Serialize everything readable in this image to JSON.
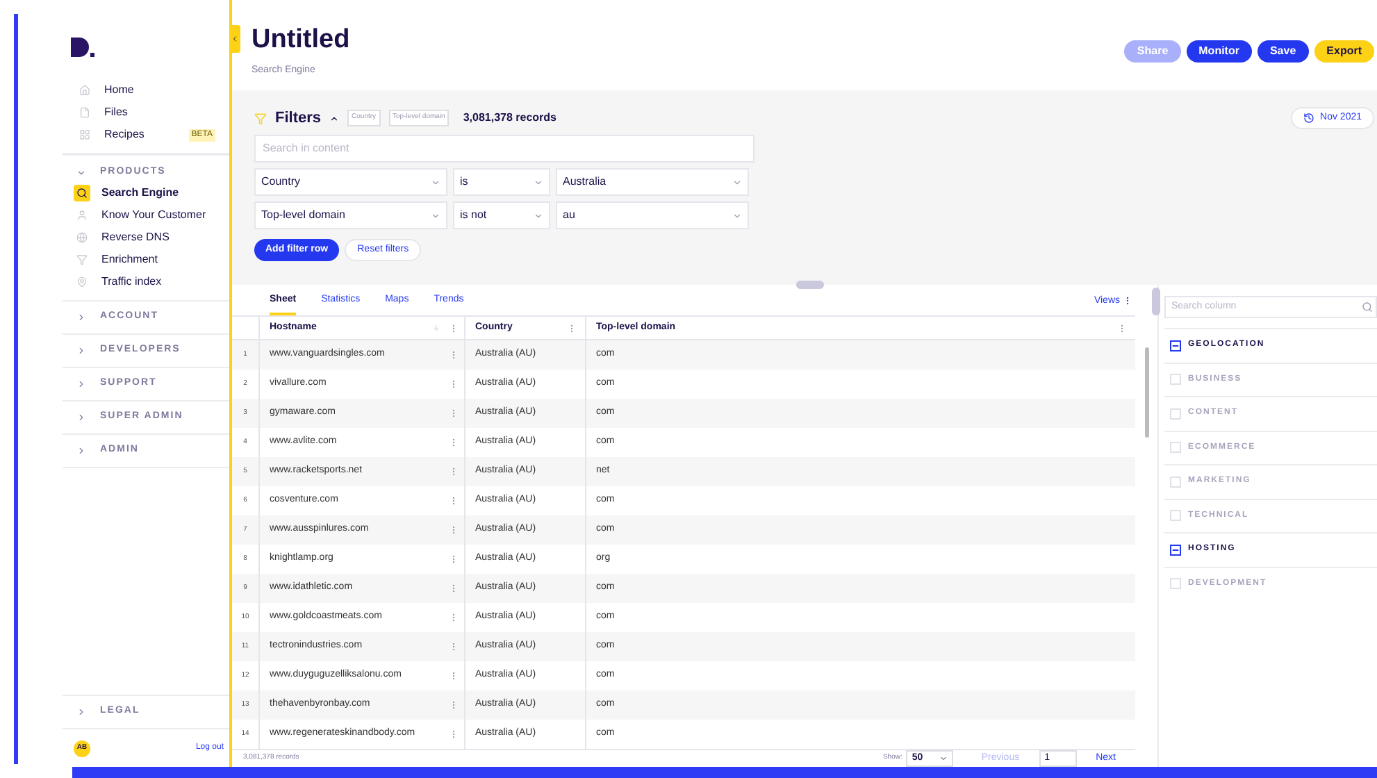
{
  "sidebar": {
    "nav": [
      {
        "label": "Home"
      },
      {
        "label": "Files"
      },
      {
        "label": "Recipes",
        "badge": "BETA"
      }
    ],
    "products": {
      "label": "PRODUCTS",
      "expanded": true,
      "items": [
        {
          "label": "Search Engine",
          "selected": true
        },
        {
          "label": "Know Your Customer",
          "selected": false
        },
        {
          "label": "Reverse DNS",
          "selected": false
        },
        {
          "label": "Enrichment",
          "selected": false
        },
        {
          "label": "Traffic index",
          "selected": false
        }
      ]
    },
    "sections": [
      {
        "label": "ACCOUNT",
        "expanded": false
      },
      {
        "label": "DEVELOPERS",
        "expanded": false
      },
      {
        "label": "SUPPORT",
        "expanded": false
      },
      {
        "label": "SUPER ADMIN",
        "expanded": false
      },
      {
        "label": "ADMIN",
        "expanded": false
      }
    ],
    "legal": {
      "label": "LEGAL",
      "expanded": false
    },
    "user": {
      "initials": "AB",
      "logout": "Log out"
    }
  },
  "header": {
    "title": "Untitled",
    "subtitle": "Search Engine",
    "buttons": [
      {
        "label": "Share",
        "kind": "disabled"
      },
      {
        "label": "Monitor",
        "kind": "primary"
      },
      {
        "label": "Save",
        "kind": "primary"
      },
      {
        "label": "Export",
        "kind": "accent"
      }
    ]
  },
  "filters": {
    "title": "Filters",
    "expanded": true,
    "tags": [
      "Country",
      "Top-level domain"
    ],
    "record_count": "3,081,378 records",
    "date": "Nov 2021",
    "search": {
      "placeholder": "Search in content"
    },
    "rows": [
      {
        "field": "Country",
        "operator": "is",
        "value": "Australia"
      },
      {
        "field": "Top-level domain",
        "operator": "is not",
        "value": "au"
      }
    ],
    "add_button": "Add filter row",
    "reset_button": "Reset filters"
  },
  "tabs": [
    {
      "label": "Sheet",
      "selected": true
    },
    {
      "label": "Statistics",
      "selected": false
    },
    {
      "label": "Maps",
      "selected": false
    },
    {
      "label": "Trends",
      "selected": false
    }
  ],
  "views": "Views",
  "table": {
    "columns": [
      "Hostname",
      "Country",
      "Top-level domain"
    ],
    "rows": [
      {
        "n": "1",
        "hostname": "www.vanguardsingles.com",
        "country": "Australia (AU)",
        "tld": "com"
      },
      {
        "n": "2",
        "hostname": "vivallure.com",
        "country": "Australia (AU)",
        "tld": "com"
      },
      {
        "n": "3",
        "hostname": "gymaware.com",
        "country": "Australia (AU)",
        "tld": "com"
      },
      {
        "n": "4",
        "hostname": "www.avlite.com",
        "country": "Australia (AU)",
        "tld": "com"
      },
      {
        "n": "5",
        "hostname": "www.racketsports.net",
        "country": "Australia (AU)",
        "tld": "net"
      },
      {
        "n": "6",
        "hostname": "cosventure.com",
        "country": "Australia (AU)",
        "tld": "com"
      },
      {
        "n": "7",
        "hostname": "www.ausspinlures.com",
        "country": "Australia (AU)",
        "tld": "com"
      },
      {
        "n": "8",
        "hostname": "knightlamp.org",
        "country": "Australia (AU)",
        "tld": "org"
      },
      {
        "n": "9",
        "hostname": "www.idathletic.com",
        "country": "Australia (AU)",
        "tld": "com"
      },
      {
        "n": "10",
        "hostname": "www.goldcoastmeats.com",
        "country": "Australia (AU)",
        "tld": "com"
      },
      {
        "n": "11",
        "hostname": "tectronindustries.com",
        "country": "Australia (AU)",
        "tld": "com"
      },
      {
        "n": "12",
        "hostname": "www.duyguguzelliksalonu.com",
        "country": "Australia (AU)",
        "tld": "com"
      },
      {
        "n": "13",
        "hostname": "thehavenbyronbay.com",
        "country": "Australia (AU)",
        "tld": "com"
      },
      {
        "n": "14",
        "hostname": "www.regenerateskinandbody.com",
        "country": "Australia (AU)",
        "tld": "com"
      }
    ]
  },
  "footer": {
    "records": "3,081,378 records",
    "show_label": "Show:",
    "page_size": "50",
    "previous": "Previous",
    "page": "1",
    "next": "Next"
  },
  "columns_panel": {
    "search": {
      "placeholder": "Search column"
    },
    "groups": [
      {
        "label": "GEOLOCATION",
        "partial": true
      },
      {
        "label": "BUSINESS",
        "partial": false
      },
      {
        "label": "CONTENT",
        "partial": false
      },
      {
        "label": "ECOMMERCE",
        "partial": false
      },
      {
        "label": "MARKETING",
        "partial": false
      },
      {
        "label": "TECHNICAL",
        "partial": false
      },
      {
        "label": "HOSTING",
        "partial": true
      },
      {
        "label": "DEVELOPMENT",
        "partial": false
      }
    ]
  }
}
